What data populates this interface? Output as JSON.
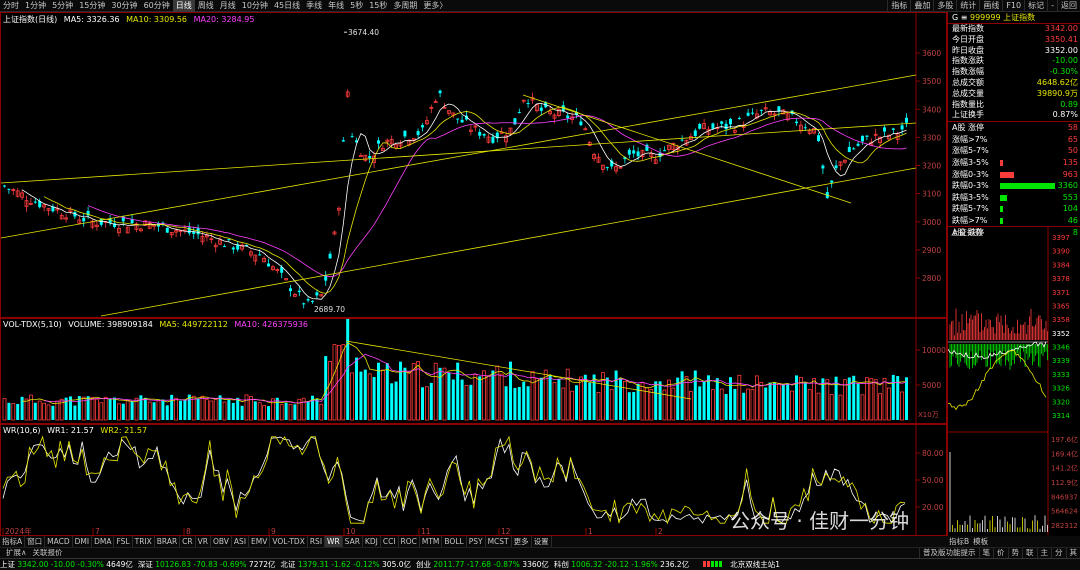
{
  "toolbar": {
    "timeframes": [
      "分时",
      "1分钟",
      "5分钟",
      "15分钟",
      "30分钟",
      "60分钟",
      "日线",
      "周线",
      "月线",
      "10分钟",
      "45日线",
      "季线",
      "年线",
      "5秒",
      "15秒",
      "多周期",
      "更多〉"
    ],
    "active": "日线",
    "right_buttons": [
      "指标",
      "叠加",
      "多股",
      "统计",
      "画线",
      "F10",
      "标记",
      "-",
      "返回"
    ]
  },
  "main_chart": {
    "title": "上证指数(日线)",
    "ma5": "MA5: 3326.36",
    "ma10": "MA10: 3309.56",
    "ma20": "MA20: 3284.95",
    "y_ticks": [
      "3600",
      "3500",
      "3400",
      "3300",
      "3200",
      "3100",
      "3000",
      "2900",
      "2800"
    ],
    "high_label": "3674.40",
    "low_label": "2689.70",
    "colors": {
      "up": "#ff3c3c",
      "down": "#00ffff",
      "ma5": "#ffffff",
      "ma10": "#e6e600",
      "ma20": "#ff40ff",
      "trendline": "#e6e600"
    }
  },
  "volume_chart": {
    "title": "VOL-TDX(5,10)",
    "volume": "VOLUME: 398909184",
    "ma5": "MA5: 449722112",
    "ma10": "MA10: 426375936",
    "y_ticks": [
      "10000",
      "5000"
    ],
    "unit": "X10万"
  },
  "wr_chart": {
    "title": "WR(10,6)",
    "wr1": "WR1: 21.57",
    "wr2": "WR2: 21.57",
    "y_ticks": [
      "80.00",
      "50.00",
      "20.00"
    ],
    "x_labels": [
      "2024年",
      "7",
      "8",
      "9",
      "10",
      "11",
      "12",
      "1",
      "2"
    ]
  },
  "info": {
    "code_title": "999999 上证指数",
    "rows": [
      {
        "label": "最新指数",
        "value": "3342.00",
        "color": "red"
      },
      {
        "label": "今日开盘",
        "value": "3350.41",
        "color": "red"
      },
      {
        "label": "昨日收盘",
        "value": "3352.00",
        "color": "white"
      },
      {
        "label": "指数涨跌",
        "value": "-10.00",
        "color": "green"
      },
      {
        "label": "指数涨幅",
        "value": "-0.30%",
        "color": "green"
      },
      {
        "label": "总成交额",
        "value": "4648.62亿",
        "color": "yellow"
      },
      {
        "label": "总成交量",
        "value": "39890.9万",
        "color": "yellow"
      },
      {
        "label": "指数量比",
        "value": "0.89",
        "color": "green"
      },
      {
        "label": "上证换手",
        "value": "0.87%",
        "color": "white"
      }
    ],
    "dist": [
      {
        "label": "A股 涨停",
        "value": "58",
        "color": "red",
        "bar": 0
      },
      {
        "label": "涨幅>7%",
        "value": "65",
        "color": "red",
        "bar": 0
      },
      {
        "label": "涨幅5-7%",
        "value": "50",
        "color": "red",
        "bar": 0
      },
      {
        "label": "涨幅3-5%",
        "value": "135",
        "color": "red",
        "bar": 0.03
      },
      {
        "label": "涨幅0-3%",
        "value": "963",
        "color": "red",
        "bar": 0.22
      },
      {
        "label": "跌幅0-3%",
        "value": "3360",
        "color": "green",
        "bar": 0.88
      },
      {
        "label": "跌幅3-5%",
        "value": "553",
        "color": "green",
        "bar": 0.12
      },
      {
        "label": "跌幅5-7%",
        "value": "104",
        "color": "green",
        "bar": 0.02
      },
      {
        "label": "跌幅>7%",
        "value": "46",
        "color": "green",
        "bar": 0.01
      },
      {
        "label": "A股 跌停",
        "value": "8",
        "color": "green",
        "bar": 0
      }
    ]
  },
  "mini_chart": {
    "title": "上证指数",
    "price_ticks": [
      "3397",
      "3390",
      "3384",
      "3378",
      "3371",
      "3365",
      "3358",
      "3352",
      "3346",
      "3339",
      "3333",
      "3326",
      "3320",
      "3314"
    ],
    "vol_ticks": [
      "197.6亿",
      "169.4亿",
      "141.2亿",
      "112.9亿",
      "846937",
      "564624",
      "282312"
    ]
  },
  "indicator_tabs": [
    "指标A",
    "窗口",
    "MACD",
    "DMI",
    "DMA",
    "FSL",
    "TRIX",
    "BRAR",
    "CR",
    "VR",
    "OBV",
    "ASI",
    "EMV",
    "VOL-TDX",
    "RSI",
    "WR",
    "SAR",
    "KDJ",
    "CCI",
    "ROC",
    "MTM",
    "BOLL",
    "PSY",
    "MCST",
    "更多",
    "设置"
  ],
  "indicator_active": "WR",
  "right_tabs": [
    "指标B",
    "模板"
  ],
  "sub_tabs": [
    "扩展∧",
    "关联报价"
  ],
  "func_tabs": [
    "普及版功能提示",
    "笔",
    "价",
    "势",
    "联",
    "主",
    "分",
    "其"
  ],
  "status": [
    {
      "name": "上证",
      "price": "3342.00",
      "chg": "-10.00",
      "pct": "-0.30%",
      "amt": "4649亿"
    },
    {
      "name": "深证",
      "price": "10126.83",
      "chg": "-70.83",
      "pct": "-0.69%",
      "amt": "7272亿"
    },
    {
      "name": "北证",
      "price": "1379.31",
      "chg": "-1.62",
      "pct": "-0.12%",
      "amt": "305.0亿"
    },
    {
      "name": "创业",
      "price": "2011.77",
      "chg": "-17.68",
      "pct": "-0.87%",
      "amt": "3360亿"
    },
    {
      "name": "科创",
      "price": "1006.32",
      "chg": "-20.12",
      "pct": "-1.96%",
      "amt": "236.2亿"
    }
  ],
  "status_extra": "北京双线主站1",
  "watermark": "公众号 · 佳财一分钟"
}
